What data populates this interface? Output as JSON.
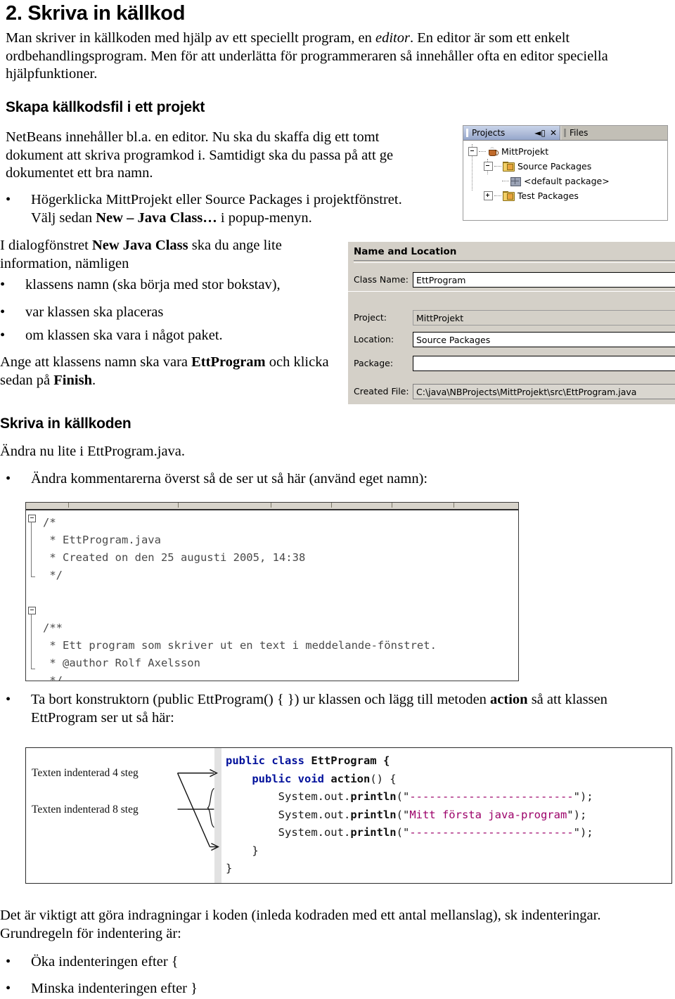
{
  "document": {
    "heading": "2. Skriva in källkod",
    "intro": {
      "before_italic": "Man skriver in källkoden med hjälp av ett speciellt program, en ",
      "italic": "editor",
      "after_italic": ". En editor är som ett enkelt ordbehandlingsprogram. Men för att underlätta för programmeraren så innehåller ofta en editor speciella hjälpfunktioner."
    },
    "section1": {
      "heading": "Skapa källkodsfil i ett projekt",
      "paragraph": "NetBeans innehåller bl.a. en editor. Nu ska du skaffa dig ett tomt dokument att skriva programkod i. Samtidigt ska du passa på att ge dokumentet ett bra namn.",
      "bullet1_line1": "Högerklicka MittProjekt eller Source Packages i projektfönstret.",
      "bullet1_line2_pre": "Välj sedan ",
      "bullet1_line2_bold": "New – Java Class…",
      "bullet1_line2_post": " i popup-menyn.",
      "dialog_intro_pre": "I dialogfönstret ",
      "dialog_intro_bold": "New Java Class",
      "dialog_intro_post": " ska du ange lite information, nämligen",
      "items": [
        "klassens namn (ska börja med stor bokstav),",
        "var klassen ska placeras",
        "om klassen ska vara i något paket."
      ],
      "closing_pre": "Ange att klassens namn ska vara ",
      "closing_bold1": "EttProgram",
      "closing_mid": " och klicka sedan på ",
      "closing_bold2": "Finish",
      "closing_post": "."
    },
    "section2": {
      "heading": "Skriva in källkoden",
      "paragraph": "Ändra nu lite i EttProgram.java.",
      "bullet": "Ändra kommentarerna överst så de ser ut så här (använd eget namn):",
      "bullet2_pre": "Ta bort konstruktorn (public EttProgram() { }) ur klassen och lägg till metoden ",
      "bullet2_bold": "action",
      "bullet2_post": " så att klassen EttProgram ser ut så här:"
    },
    "section3": {
      "paragraph": "Det är viktigt att göra indragningar i koden (inleda kodraden med ett antal mellanslag), sk indenteringar. Grundregeln för indentering är:",
      "items": [
        "Öka indenteringen efter {",
        "Minska indenteringen efter }"
      ]
    }
  },
  "projects_panel": {
    "tabs": [
      {
        "label": "Projects",
        "active": true
      },
      {
        "label": "Files",
        "active": false
      }
    ],
    "minimize_glyph": "◄▯",
    "close_glyph": "✕",
    "tree": [
      {
        "label": "MittProjekt",
        "level": 1,
        "expander": "minus",
        "icon": "coffee-cup-icon"
      },
      {
        "label": "Source Packages",
        "level": 2,
        "expander": "minus",
        "icon": "folder-icon"
      },
      {
        "label": "<default package>",
        "level": 3,
        "expander": "none",
        "icon": "package-icon"
      },
      {
        "label": "Test Packages",
        "level": 2,
        "expander": "plus",
        "icon": "folder-icon"
      }
    ]
  },
  "new_java_class_dialog": {
    "title": "Name and Location",
    "fields": [
      {
        "label": "Class Name:",
        "value": "EttProgram",
        "style": "input"
      },
      {
        "label": "Project:",
        "value": "MittProjekt",
        "style": "readonly"
      },
      {
        "label": "Location:",
        "value": "Source Packages",
        "style": "input"
      },
      {
        "label": "Package:",
        "value": "",
        "style": "input"
      },
      {
        "label": "Created File:",
        "value": "C:\\java\\NBProjects\\MittProjekt\\src\\EttProgram.java",
        "style": "sunken"
      }
    ]
  },
  "code_screenshot_1": {
    "lines": [
      "/*",
      " * EttProgram.java",
      " * Created on den 25 augusti 2005, 14:38",
      " */",
      "",
      "",
      "/**",
      " * Ett program som skriver ut en text i meddelande-fönstret.",
      " * @author Rolf Axelsson",
      " */"
    ]
  },
  "code_screenshot_2": {
    "annotations": [
      "Texten indenterad 4 steg",
      "Texten indenterad 8 steg"
    ],
    "code": {
      "line1_kw": "public class",
      "line1_rest": " EttProgram {",
      "line2_kw": "public void",
      "line2_name": " action",
      "line2_rest": "() {",
      "line3_pre": "System.out.",
      "line3_call": "println",
      "line3_open": "(\"",
      "line3_str": "-------------------------",
      "line3_close": "\");",
      "line4_str": "Mitt första java-program",
      "line5_str": "-------------------------",
      "line6": "}",
      "line7": "}"
    }
  }
}
